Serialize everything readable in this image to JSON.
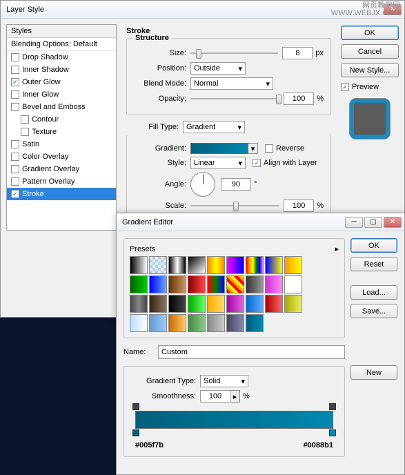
{
  "watermark": {
    "line1": "网页教学网",
    "line2": "WWW.WEBJX.COM"
  },
  "layerStyle": {
    "title": "Layer Style",
    "stylesHeader": "Styles",
    "blendingDefault": "Blending Options: Default",
    "items": [
      {
        "label": "Drop Shadow",
        "checked": false
      },
      {
        "label": "Inner Shadow",
        "checked": false
      },
      {
        "label": "Outer Glow",
        "checked": true
      },
      {
        "label": "Inner Glow",
        "checked": false
      },
      {
        "label": "Bevel and Emboss",
        "checked": false
      },
      {
        "label": "Contour",
        "checked": false,
        "indent": true
      },
      {
        "label": "Texture",
        "checked": false,
        "indent": true
      },
      {
        "label": "Satin",
        "checked": false
      },
      {
        "label": "Color Overlay",
        "checked": false
      },
      {
        "label": "Gradient Overlay",
        "checked": false
      },
      {
        "label": "Pattern Overlay",
        "checked": false
      },
      {
        "label": "Stroke",
        "checked": true,
        "selected": true
      }
    ],
    "panelTitle": "Stroke",
    "structure": {
      "legend": "Structure",
      "sizeLabel": "Size:",
      "size": "8",
      "sizeUnit": "px",
      "positionLabel": "Position:",
      "position": "Outside",
      "blendModeLabel": "Blend Mode:",
      "blendMode": "Normal",
      "opacityLabel": "Opacity:",
      "opacity": "100",
      "opacityUnit": "%"
    },
    "fillTypeLabel": "Fill Type:",
    "fillType": "Gradient",
    "gradientLabel": "Gradient:",
    "reverseLabel": "Reverse",
    "reverse": false,
    "styleLabel": "Style:",
    "style": "Linear",
    "alignLabel": "Align with Layer",
    "align": true,
    "angleLabel": "Angle:",
    "angle": "90",
    "angleUnit": "°",
    "scaleLabel": "Scale:",
    "scale": "100",
    "scaleUnit": "%",
    "buttons": {
      "ok": "OK",
      "cancel": "Cancel",
      "newStyle": "New Style...",
      "previewLabel": "Preview",
      "preview": true
    }
  },
  "gradientEditor": {
    "title": "Gradient Editor",
    "presetsLabel": "Presets",
    "presets": [
      "linear-gradient(90deg,#000,#fff)",
      "repeating-conic-gradient(#bcd 0 25%,#def 0 50%) 0/8px 8px",
      "linear-gradient(90deg,#000,#fff,#000)",
      "linear-gradient(135deg,#000,#fff)",
      "linear-gradient(90deg,#f80,#ff0,#f80)",
      "linear-gradient(90deg,#f0f,#00f)",
      "linear-gradient(90deg,red,orange,yellow,green,blue,violet)",
      "linear-gradient(90deg,#00f,#ff0)",
      "linear-gradient(90deg,#f90,#ff0)",
      "linear-gradient(90deg,#060,#0c0)",
      "linear-gradient(90deg,#00f,#6af)",
      "linear-gradient(90deg,#630,#c96)",
      "linear-gradient(90deg,#800,#f44)",
      "linear-gradient(90deg,red,green,blue)",
      "repeating-linear-gradient(45deg,red 0 4px,orange 4px 8px,yellow 8px 12px)",
      "linear-gradient(90deg,#333,#999)",
      "linear-gradient(90deg,#c3c,#f8f)",
      "#fff",
      "linear-gradient(90deg,#444,#888,#444)",
      "linear-gradient(90deg,#321,#876)",
      "linear-gradient(90deg,#000,#444)",
      "linear-gradient(90deg,#0a0,#6f6)",
      "linear-gradient(90deg,#fa0,#fd6)",
      "linear-gradient(90deg,#a0a,#d6d)",
      "linear-gradient(90deg,#06c,#6af)",
      "linear-gradient(90deg,#a00,#f66)",
      "linear-gradient(90deg,#aa0,#ee6)",
      "linear-gradient(90deg,#bdf,#fff)",
      "linear-gradient(90deg,#69c,#9cf)",
      "linear-gradient(90deg,#c60,#fc6)",
      "linear-gradient(90deg,#484,#8c8)",
      "linear-gradient(90deg,#888,#ccc)",
      "linear-gradient(90deg,#446,#88a)",
      "linear-gradient(90deg,#005f7b,#0088b1)"
    ],
    "nameLabel": "Name:",
    "name": "Custom",
    "newBtn": "New",
    "typeLabel": "Gradient Type:",
    "type": "Solid",
    "smoothLabel": "Smoothness:",
    "smooth": "100",
    "smoothUnit": "%",
    "buttons": {
      "ok": "OK",
      "reset": "Reset",
      "load": "Load...",
      "save": "Save..."
    },
    "hexLeft": "#005f7b",
    "hexRight": "#0088b1"
  }
}
